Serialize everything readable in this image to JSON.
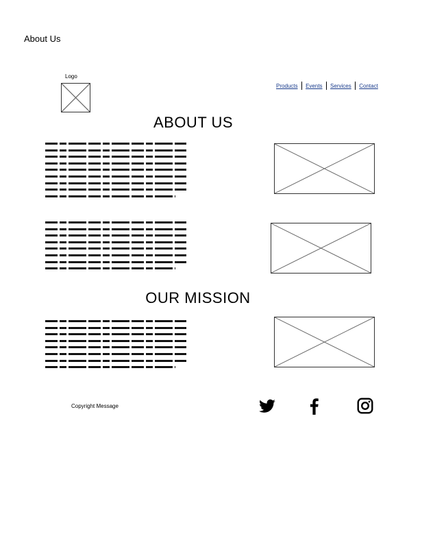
{
  "page_title": "About Us",
  "header": {
    "logo_label": "Logo",
    "nav": [
      "Products",
      "Events",
      "Services",
      "Contact"
    ]
  },
  "sections": {
    "about_heading": "ABOUT US",
    "mission_heading": "OUR MISSION"
  },
  "footer": {
    "copyright": "Copyright Message",
    "social_icons": [
      "twitter-icon",
      "facebook-icon",
      "instagram-icon"
    ]
  }
}
